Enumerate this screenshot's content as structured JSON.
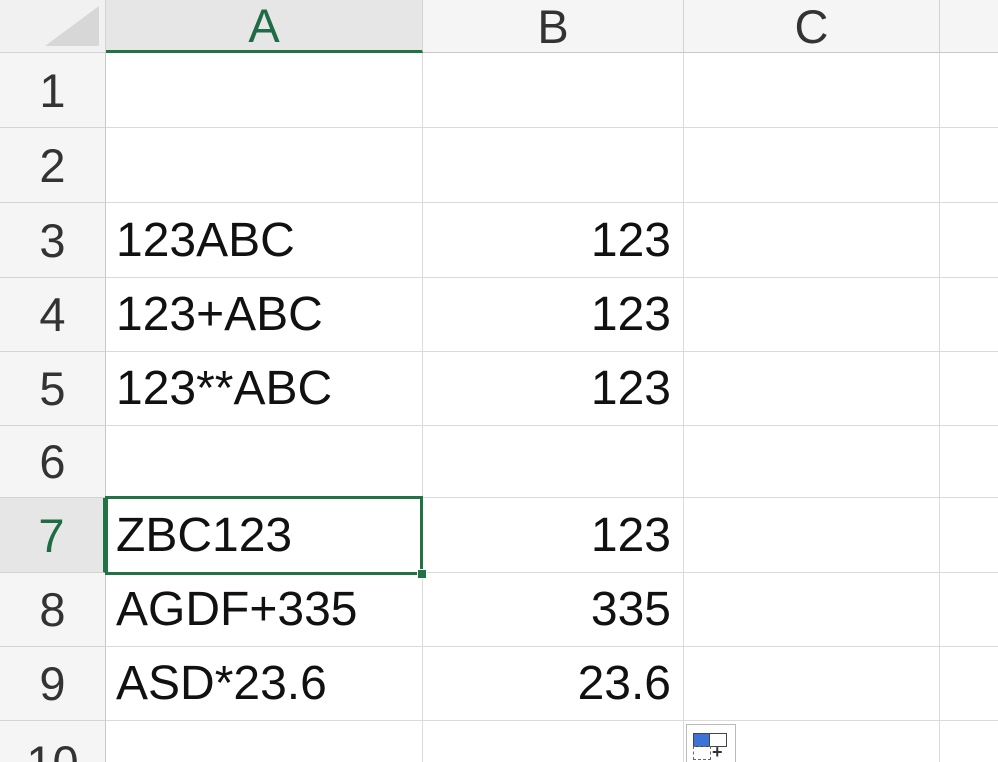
{
  "columns": [
    {
      "label": "A",
      "active": true
    },
    {
      "label": "B",
      "active": false
    },
    {
      "label": "C",
      "active": false
    }
  ],
  "rows": [
    {
      "label": "1",
      "a": "",
      "b": ""
    },
    {
      "label": "2",
      "a": "",
      "b": ""
    },
    {
      "label": "3",
      "a": "123ABC",
      "b": "123"
    },
    {
      "label": "4",
      "a": "123+ABC",
      "b": "123"
    },
    {
      "label": "5",
      "a": "123**ABC",
      "b": "123"
    },
    {
      "label": "6",
      "a": "",
      "b": ""
    },
    {
      "label": "7",
      "a": "ZBC123",
      "b": "123"
    },
    {
      "label": "8",
      "a": "AGDF+335",
      "b": "335"
    },
    {
      "label": "9",
      "a": "ASD*23.6",
      "b": "23.6"
    },
    {
      "label": "10",
      "a": "",
      "b": ""
    }
  ],
  "selected_cell": "A7",
  "colors": {
    "selection": "#217346",
    "header_bg": "#f5f5f5",
    "grid": "#dadada"
  },
  "icons": {
    "paste_options": "paste-options-icon"
  }
}
